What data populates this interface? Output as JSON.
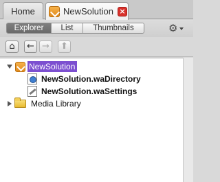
{
  "tabs": [
    {
      "label": "Home"
    },
    {
      "label": "NewSolution"
    }
  ],
  "toolbar": {
    "views": [
      "Explorer",
      "List",
      "Thumbnails"
    ],
    "active_view": "Explorer"
  },
  "nav": {
    "home": "⌂",
    "back": "←",
    "forward": "→",
    "up": "⬆"
  },
  "tree": {
    "root": {
      "label": "NewSolution",
      "expanded": true,
      "selected": true
    },
    "children": [
      {
        "label": "NewSolution.waDirectory",
        "icon": "directory-file-icon"
      },
      {
        "label": "NewSolution.waSettings",
        "icon": "settings-file-icon"
      }
    ],
    "media": {
      "label": "Media Library",
      "expanded": false
    }
  },
  "colors": {
    "selection": "#7c4fd0",
    "solution_icon": "#f0a232",
    "close_button": "#d8322c"
  }
}
